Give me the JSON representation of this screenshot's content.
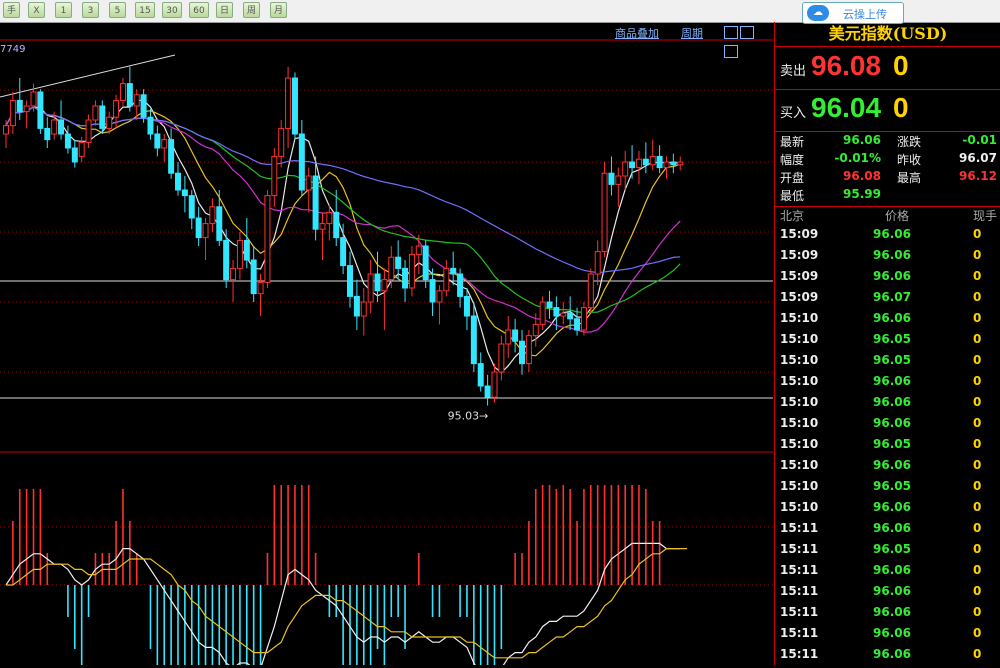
{
  "toolbar": {
    "buttons": [
      "手",
      "X",
      "1",
      "3",
      "5",
      "15",
      "30",
      "60",
      "日",
      "周",
      "月"
    ],
    "cloud_label": "云操上传"
  },
  "chart": {
    "links": {
      "overlay": "商品叠加",
      "period": "周期"
    },
    "ma_label": "7749",
    "low_annotation": "95.03",
    "chart_data": {
      "type": "candlestick",
      "title": "",
      "y_range": [
        94.9,
        96.3
      ],
      "candles": [
        [
          96.0,
          96.05,
          95.95,
          96.03
        ],
        [
          96.03,
          96.15,
          96.0,
          96.12
        ],
        [
          96.12,
          96.2,
          96.05,
          96.08
        ],
        [
          96.08,
          96.12,
          96.02,
          96.1
        ],
        [
          96.1,
          96.18,
          96.08,
          96.15
        ],
        [
          96.15,
          96.16,
          96.0,
          96.02
        ],
        [
          96.02,
          96.06,
          95.95,
          95.98
        ],
        [
          96.0,
          96.08,
          95.98,
          96.05
        ],
        [
          96.05,
          96.12,
          95.98,
          96.0
        ],
        [
          96.0,
          96.03,
          95.93,
          95.95
        ],
        [
          95.95,
          95.98,
          95.88,
          95.9
        ],
        [
          95.92,
          95.99,
          95.9,
          95.97
        ],
        [
          95.97,
          96.07,
          95.95,
          96.05
        ],
        [
          96.05,
          96.12,
          96.03,
          96.1
        ],
        [
          96.1,
          96.12,
          96.0,
          96.02
        ],
        [
          96.02,
          96.08,
          96.0,
          96.06
        ],
        [
          96.06,
          96.14,
          96.02,
          96.12
        ],
        [
          96.12,
          96.2,
          96.1,
          96.18
        ],
        [
          96.18,
          96.24,
          96.08,
          96.1
        ],
        [
          96.1,
          96.16,
          96.05,
          96.14
        ],
        [
          96.14,
          96.16,
          96.04,
          96.06
        ],
        [
          96.06,
          96.09,
          95.98,
          96.0
        ],
        [
          96.0,
          96.03,
          95.92,
          95.95
        ],
        [
          95.95,
          96.0,
          95.9,
          95.98
        ],
        [
          95.98,
          96.02,
          95.84,
          95.86
        ],
        [
          95.86,
          95.9,
          95.78,
          95.8
        ],
        [
          95.8,
          95.85,
          95.72,
          95.78
        ],
        [
          95.78,
          95.8,
          95.66,
          95.7
        ],
        [
          95.7,
          95.74,
          95.6,
          95.63
        ],
        [
          95.63,
          95.7,
          95.55,
          95.68
        ],
        [
          95.68,
          95.77,
          95.65,
          95.74
        ],
        [
          95.74,
          95.8,
          95.6,
          95.62
        ],
        [
          95.62,
          95.66,
          95.45,
          95.48
        ],
        [
          95.48,
          95.55,
          95.4,
          95.52
        ],
        [
          95.52,
          95.65,
          95.48,
          95.62
        ],
        [
          95.62,
          95.7,
          95.52,
          95.55
        ],
        [
          95.55,
          95.6,
          95.4,
          95.43
        ],
        [
          95.43,
          95.5,
          95.35,
          95.47
        ],
        [
          95.47,
          95.8,
          95.45,
          95.78
        ],
        [
          95.78,
          95.95,
          95.74,
          95.92
        ],
        [
          95.92,
          96.05,
          95.88,
          96.02
        ],
        [
          96.02,
          96.24,
          95.95,
          96.2
        ],
        [
          96.2,
          96.22,
          95.98,
          96.0
        ],
        [
          96.0,
          96.05,
          95.78,
          95.8
        ],
        [
          95.8,
          95.88,
          95.72,
          95.85
        ],
        [
          95.85,
          95.92,
          95.62,
          95.66
        ],
        [
          95.66,
          95.72,
          95.55,
          95.68
        ],
        [
          95.68,
          95.75,
          95.62,
          95.72
        ],
        [
          95.72,
          95.8,
          95.6,
          95.63
        ],
        [
          95.63,
          95.68,
          95.5,
          95.53
        ],
        [
          95.53,
          95.58,
          95.38,
          95.42
        ],
        [
          95.42,
          95.48,
          95.3,
          95.35
        ],
        [
          95.35,
          95.45,
          95.28,
          95.4
        ],
        [
          95.4,
          95.55,
          95.36,
          95.5
        ],
        [
          95.5,
          95.58,
          95.4,
          95.44
        ],
        [
          95.44,
          95.52,
          95.3,
          95.48
        ],
        [
          95.48,
          95.6,
          95.45,
          95.56
        ],
        [
          95.56,
          95.62,
          95.48,
          95.52
        ],
        [
          95.52,
          95.55,
          95.4,
          95.45
        ],
        [
          95.45,
          95.6,
          95.42,
          95.57
        ],
        [
          95.57,
          95.64,
          95.5,
          95.6
        ],
        [
          95.6,
          95.62,
          95.45,
          95.48
        ],
        [
          95.48,
          95.52,
          95.35,
          95.4
        ],
        [
          95.4,
          95.46,
          95.32,
          95.44
        ],
        [
          95.44,
          95.55,
          95.42,
          95.52
        ],
        [
          95.52,
          95.58,
          95.46,
          95.5
        ],
        [
          95.5,
          95.52,
          95.38,
          95.42
        ],
        [
          95.42,
          95.45,
          95.3,
          95.35
        ],
        [
          95.35,
          95.4,
          95.15,
          95.18
        ],
        [
          95.18,
          95.22,
          95.08,
          95.1
        ],
        [
          95.1,
          95.14,
          95.03,
          95.06
        ],
        [
          95.06,
          95.18,
          95.04,
          95.15
        ],
        [
          95.15,
          95.28,
          95.12,
          95.25
        ],
        [
          95.25,
          95.35,
          95.2,
          95.3
        ],
        [
          95.3,
          95.34,
          95.22,
          95.26
        ],
        [
          95.26,
          95.3,
          95.14,
          95.18
        ],
        [
          95.18,
          95.3,
          95.15,
          95.28
        ],
        [
          95.28,
          95.36,
          95.24,
          95.32
        ],
        [
          95.32,
          95.42,
          95.3,
          95.4
        ],
        [
          95.4,
          95.44,
          95.34,
          95.38
        ],
        [
          95.38,
          95.42,
          95.3,
          95.35
        ],
        [
          95.35,
          95.4,
          95.32,
          95.36
        ],
        [
          95.36,
          95.42,
          95.3,
          95.34
        ],
        [
          95.34,
          95.38,
          95.28,
          95.3
        ],
        [
          95.3,
          95.4,
          95.28,
          95.38
        ],
        [
          95.38,
          95.52,
          95.36,
          95.5
        ],
        [
          95.5,
          95.62,
          95.46,
          95.58
        ],
        [
          95.58,
          95.9,
          95.56,
          95.86
        ],
        [
          95.86,
          95.92,
          95.78,
          95.82
        ],
        [
          95.82,
          95.88,
          95.74,
          95.85
        ],
        [
          95.85,
          95.94,
          95.8,
          95.9
        ],
        [
          95.9,
          95.96,
          95.84,
          95.88
        ],
        [
          95.88,
          95.94,
          95.82,
          95.91
        ],
        [
          95.91,
          95.97,
          95.86,
          95.89
        ],
        [
          95.89,
          95.98,
          95.87,
          95.92
        ],
        [
          95.92,
          95.96,
          95.86,
          95.88
        ],
        [
          95.88,
          95.92,
          95.84,
          95.9
        ],
        [
          95.9,
          95.93,
          95.86,
          95.89
        ],
        [
          95.89,
          95.92,
          95.87,
          95.9
        ]
      ],
      "macd_dif": [
        0.0,
        0.02,
        0.04,
        0.05,
        0.06,
        0.06,
        0.05,
        0.04,
        0.04,
        0.03,
        0.01,
        0.0,
        0.01,
        0.03,
        0.04,
        0.04,
        0.05,
        0.07,
        0.07,
        0.06,
        0.05,
        0.03,
        0.01,
        -0.01,
        -0.03,
        -0.05,
        -0.07,
        -0.09,
        -0.11,
        -0.12,
        -0.12,
        -0.13,
        -0.15,
        -0.16,
        -0.15,
        -0.15,
        -0.16,
        -0.16,
        -0.12,
        -0.08,
        -0.03,
        0.02,
        0.03,
        0.02,
        0.01,
        -0.01,
        -0.02,
        -0.03,
        -0.04,
        -0.06,
        -0.08,
        -0.1,
        -0.11,
        -0.1,
        -0.1,
        -0.11,
        -0.1,
        -0.1,
        -0.11,
        -0.1,
        -0.09,
        -0.1,
        -0.11,
        -0.11,
        -0.1,
        -0.1,
        -0.11,
        -0.12,
        -0.15,
        -0.17,
        -0.19,
        -0.18,
        -0.16,
        -0.14,
        -0.13,
        -0.13,
        -0.11,
        -0.1,
        -0.08,
        -0.07,
        -0.07,
        -0.06,
        -0.06,
        -0.06,
        -0.05,
        -0.03,
        -0.01,
        0.03,
        0.05,
        0.06,
        0.07,
        0.08,
        0.08,
        0.08,
        0.08,
        0.08,
        0.07,
        0.07,
        0.07
      ],
      "macd_dea": [
        0.0,
        0.0,
        0.01,
        0.02,
        0.03,
        0.03,
        0.04,
        0.04,
        0.04,
        0.04,
        0.03,
        0.03,
        0.02,
        0.02,
        0.03,
        0.03,
        0.03,
        0.04,
        0.05,
        0.05,
        0.05,
        0.05,
        0.04,
        0.03,
        0.02,
        0.0,
        -0.01,
        -0.03,
        -0.04,
        -0.06,
        -0.07,
        -0.08,
        -0.09,
        -0.1,
        -0.11,
        -0.12,
        -0.13,
        -0.13,
        -0.13,
        -0.12,
        -0.11,
        -0.08,
        -0.06,
        -0.04,
        -0.03,
        -0.02,
        -0.02,
        -0.02,
        -0.03,
        -0.03,
        -0.04,
        -0.05,
        -0.06,
        -0.07,
        -0.08,
        -0.08,
        -0.09,
        -0.09,
        -0.09,
        -0.1,
        -0.1,
        -0.1,
        -0.1,
        -0.1,
        -0.1,
        -0.1,
        -0.1,
        -0.11,
        -0.11,
        -0.12,
        -0.13,
        -0.14,
        -0.14,
        -0.14,
        -0.14,
        -0.14,
        -0.13,
        -0.13,
        -0.12,
        -0.11,
        -0.1,
        -0.1,
        -0.09,
        -0.08,
        -0.08,
        -0.07,
        -0.06,
        -0.04,
        -0.03,
        -0.01,
        0.01,
        0.02,
        0.04,
        0.05,
        0.06,
        0.06,
        0.07,
        0.07,
        0.07,
        0.07
      ]
    }
  },
  "panel": {
    "title": "美元指数(USD)",
    "sell": {
      "label": "卖出",
      "price": "96.08",
      "volume": "0"
    },
    "buy": {
      "label": "买入",
      "price": "96.04",
      "volume": "0"
    },
    "stats": [
      {
        "label": "最新",
        "value": "96.06",
        "color": "#33ee33"
      },
      {
        "label": "涨跌",
        "value": "-0.01",
        "color": "#33ee33"
      },
      {
        "label": "幅度",
        "value": "-0.01%",
        "color": "#33ee33"
      },
      {
        "label": "昨收",
        "value": "96.07",
        "color": "#eeeeee"
      },
      {
        "label": "开盘",
        "value": "96.08",
        "color": "#ff3333"
      },
      {
        "label": "最高",
        "value": "96.12",
        "color": "#ff3333"
      },
      {
        "label": "最低",
        "value": "95.99",
        "color": "#33ee33"
      }
    ],
    "ticks_header": {
      "time": "北京",
      "price": "价格",
      "volume": "现手"
    },
    "ticks": [
      {
        "time": "15:09",
        "price": "96.06",
        "volume": "0"
      },
      {
        "time": "15:09",
        "price": "96.06",
        "volume": "0"
      },
      {
        "time": "15:09",
        "price": "96.06",
        "volume": "0"
      },
      {
        "time": "15:09",
        "price": "96.07",
        "volume": "0"
      },
      {
        "time": "15:10",
        "price": "96.06",
        "volume": "0"
      },
      {
        "time": "15:10",
        "price": "96.05",
        "volume": "0"
      },
      {
        "time": "15:10",
        "price": "96.05",
        "volume": "0"
      },
      {
        "time": "15:10",
        "price": "96.06",
        "volume": "0"
      },
      {
        "time": "15:10",
        "price": "96.06",
        "volume": "0"
      },
      {
        "time": "15:10",
        "price": "96.06",
        "volume": "0"
      },
      {
        "time": "15:10",
        "price": "96.05",
        "volume": "0"
      },
      {
        "time": "15:10",
        "price": "96.06",
        "volume": "0"
      },
      {
        "time": "15:10",
        "price": "96.05",
        "volume": "0"
      },
      {
        "time": "15:10",
        "price": "96.06",
        "volume": "0"
      },
      {
        "time": "15:11",
        "price": "96.06",
        "volume": "0"
      },
      {
        "time": "15:11",
        "price": "96.05",
        "volume": "0"
      },
      {
        "time": "15:11",
        "price": "96.06",
        "volume": "0"
      },
      {
        "time": "15:11",
        "price": "96.06",
        "volume": "0"
      },
      {
        "time": "15:11",
        "price": "96.06",
        "volume": "0"
      },
      {
        "time": "15:11",
        "price": "96.06",
        "volume": "0"
      },
      {
        "time": "15:11",
        "price": "96.06",
        "volume": "0"
      }
    ]
  }
}
